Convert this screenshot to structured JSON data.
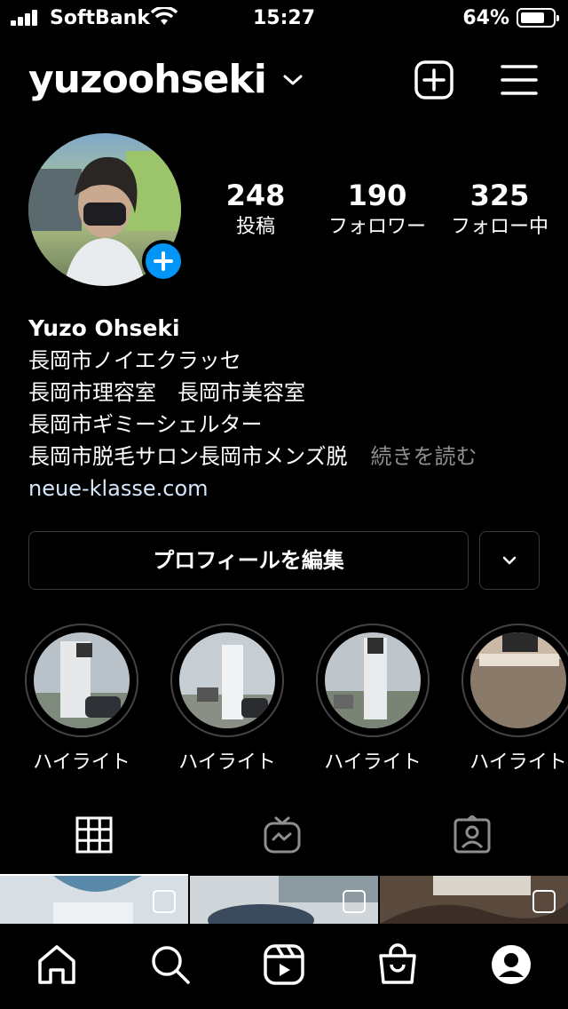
{
  "status_bar": {
    "carrier": "SoftBank",
    "time": "15:27",
    "battery": "64%"
  },
  "header": {
    "username": "yuzoohseki"
  },
  "stats": [
    {
      "value": "248",
      "label": "投稿"
    },
    {
      "value": "190",
      "label": "フォロワー"
    },
    {
      "value": "325",
      "label": "フォロー中"
    }
  ],
  "bio": {
    "name": "Yuzo Ohseki",
    "lines": [
      "長岡市ノイエクラッセ",
      "長岡市理容室　長岡市美容室",
      "長岡市ギミーシェルター",
      "長岡市脱毛サロン長岡市メンズ脱"
    ],
    "more": "続きを読む",
    "link": "neue-klasse.com"
  },
  "actions": {
    "edit_profile": "プロフィールを編集"
  },
  "highlights": [
    {
      "label": "ハイライト"
    },
    {
      "label": "ハイライト"
    },
    {
      "label": "ハイライト"
    },
    {
      "label": "ハイライト"
    }
  ],
  "tabs": [
    {
      "icon": "grid-icon"
    },
    {
      "icon": "igtv-icon"
    },
    {
      "icon": "tagged-icon"
    }
  ],
  "bottom_nav": [
    {
      "icon": "home-icon"
    },
    {
      "icon": "search-icon"
    },
    {
      "icon": "reels-icon"
    },
    {
      "icon": "shop-icon"
    },
    {
      "icon": "profile-icon"
    }
  ],
  "colors": {
    "accent": "#0095f6",
    "link": "#d4e6fa",
    "muted": "#8e8e8e"
  }
}
